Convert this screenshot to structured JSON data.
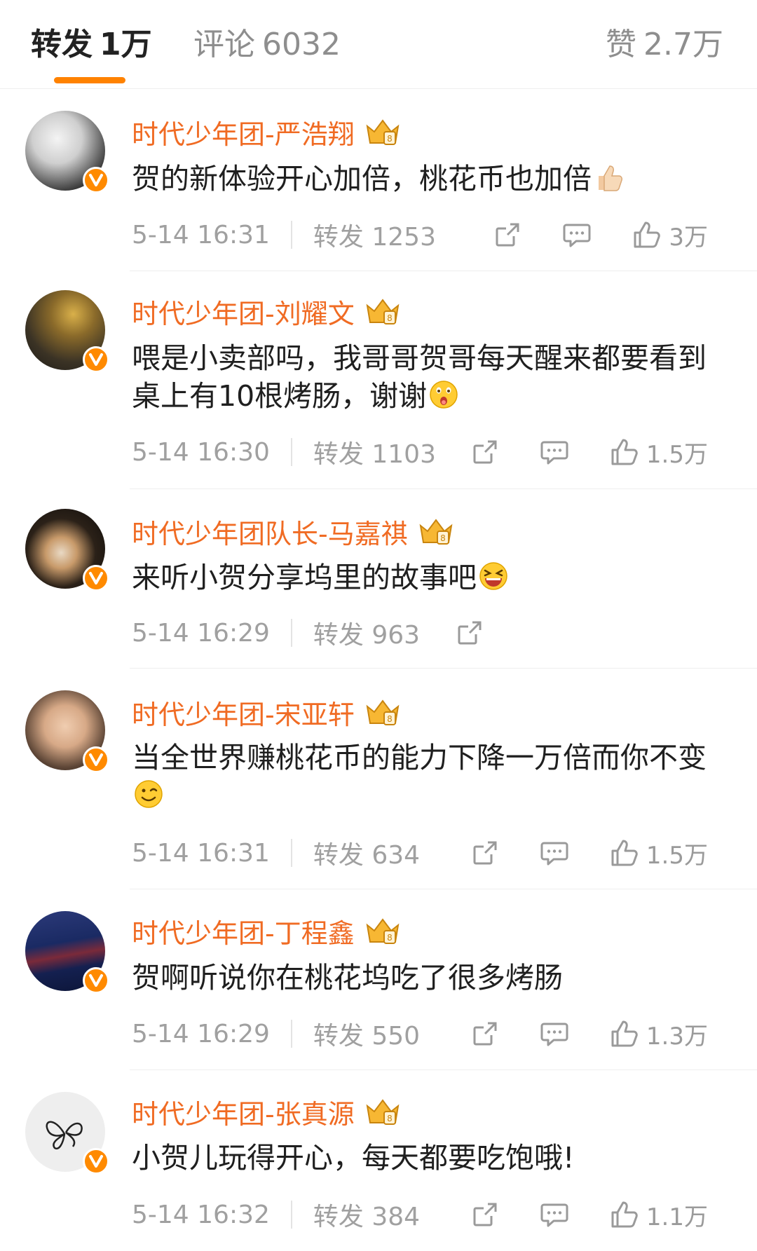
{
  "tabs": {
    "repost": {
      "label": "转发",
      "count": "1万"
    },
    "comment": {
      "label": "评论",
      "count": "6032"
    },
    "like": {
      "label": "赞",
      "count": "2.7万"
    }
  },
  "accent_color": "#ff8200",
  "name_color": "#f06b23",
  "comments": [
    {
      "name": "时代少年团-严浩翔",
      "text": "贺的新体验开心加倍，桃花币也加倍",
      "emoji": "thumbs-up",
      "time": "5-14 16:31",
      "repost": "转发 1253",
      "likes": "3万"
    },
    {
      "name": "时代少年团-刘耀文",
      "text": "喂是小卖部吗，我哥哥贺哥每天醒来都要看到桌上有10根烤肠，谢谢",
      "emoji": "surprised-face",
      "time": "5-14 16:30",
      "repost": "转发 1103",
      "likes": "1.5万"
    },
    {
      "name": "时代少年团队长-马嘉祺",
      "text": "来听小贺分享坞里的故事吧",
      "emoji": "laughing-face",
      "time": "5-14 16:29",
      "repost": "转发 963",
      "likes": ""
    },
    {
      "name": "时代少年团-宋亚轩",
      "text": "当全世界赚桃花币的能力下降一万倍而你不变",
      "emoji": "wink-face",
      "time": "5-14 16:31",
      "repost": "转发 634",
      "likes": "1.5万"
    },
    {
      "name": "时代少年团-丁程鑫",
      "text": "贺啊听说你在桃花坞吃了很多烤肠",
      "emoji": "",
      "time": "5-14 16:29",
      "repost": "转发 550",
      "likes": "1.3万"
    },
    {
      "name": "时代少年团-张真源",
      "text": "小贺儿玩得开心，每天都要吃饱哦!",
      "emoji": "",
      "time": "5-14 16:32",
      "repost": "转发 384",
      "likes": "1.1万"
    }
  ]
}
